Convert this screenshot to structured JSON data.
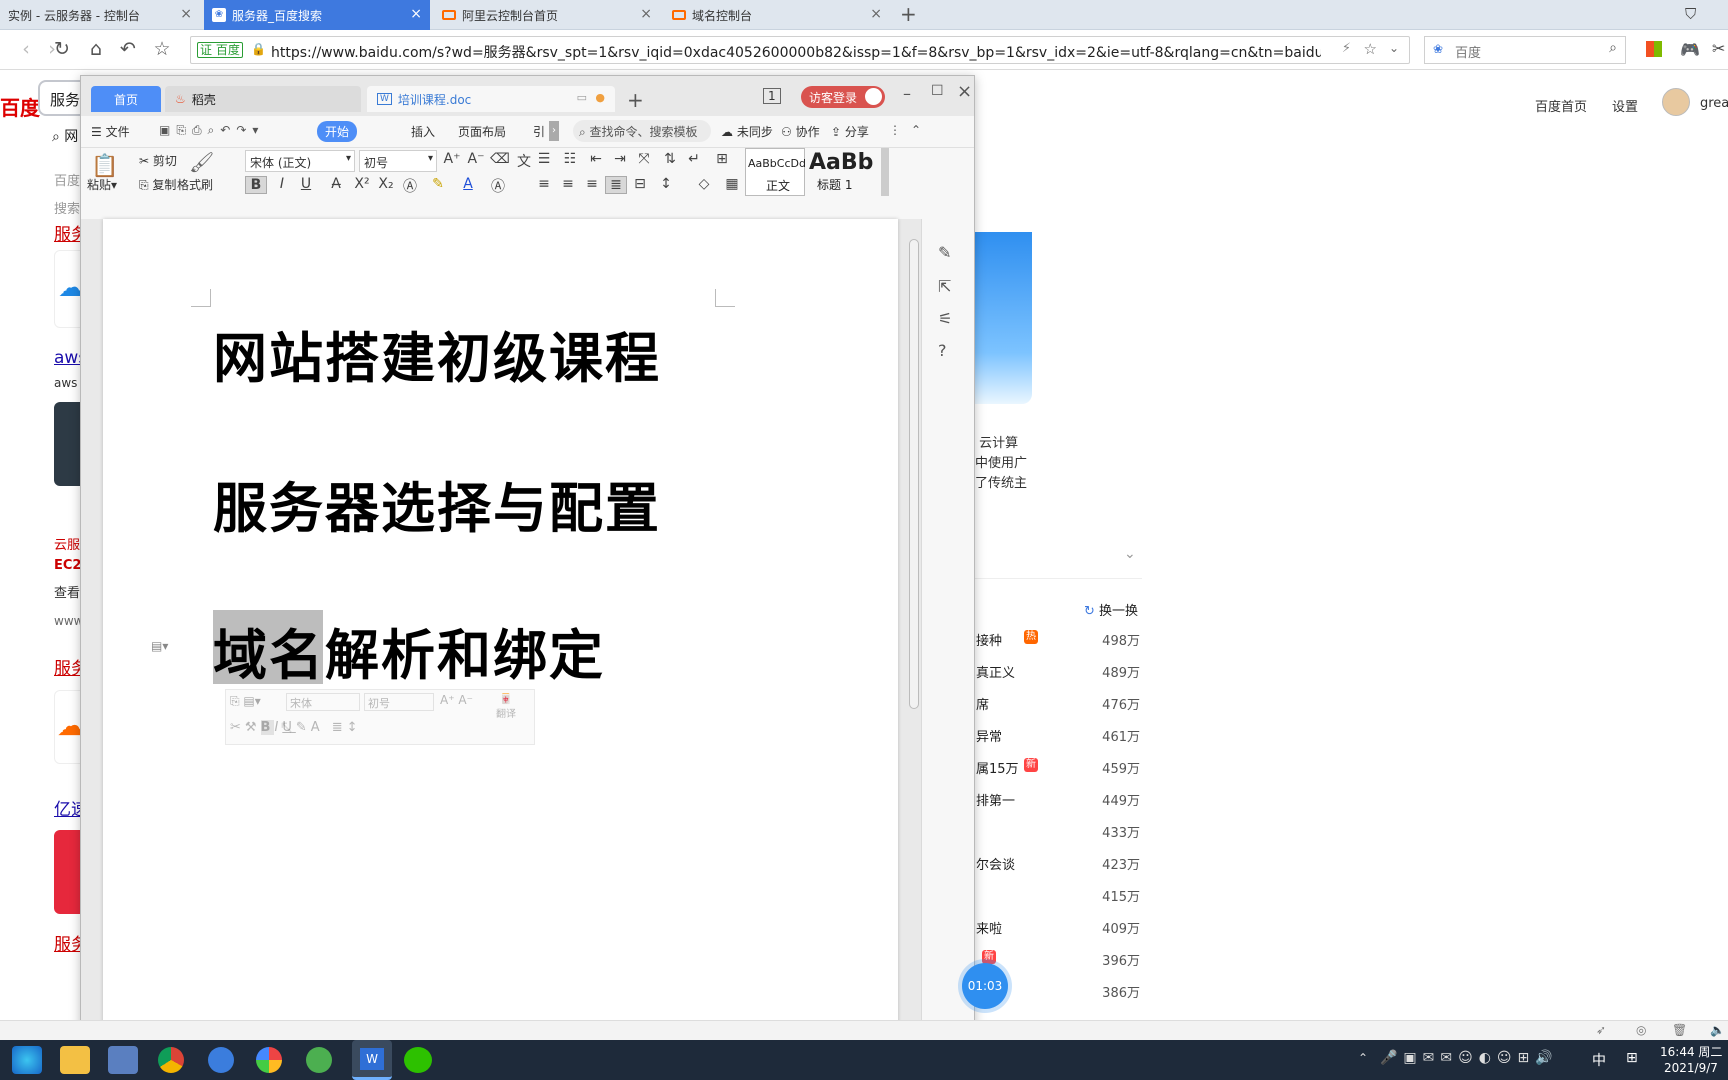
{
  "browser": {
    "tabs": [
      {
        "title": "实例 - 云服务器 - 控制台"
      },
      {
        "title": "服务器_百度搜索"
      },
      {
        "title": "阿里云控制台首页"
      },
      {
        "title": "域名控制台"
      }
    ],
    "cert_label": "证 百度",
    "url": "https://www.baidu.com/s?wd=服务器&rsv_spt=1&rsv_iqid=0xdac4052600000b82&issp=1&f=8&rsv_bp=1&rsv_idx=2&ie=utf-8&rqlang=cn&tn=baiduhome_p",
    "search_placeholder": "百度"
  },
  "baidu": {
    "logo_fragment": "百度",
    "query_fragment": "服务",
    "tab_fragment": "网",
    "header_links": {
      "home": "百度首页",
      "settings": "设置",
      "user": "great"
    },
    "left_fragments": [
      "百度",
      "搜索",
      "服务",
      "aws",
      "aws",
      "云服",
      "EC2",
      "查看",
      "www",
      "服务",
      "亿速",
      "服务"
    ],
    "right_card_text": [
      "用 云计算",
      "系中使用广",
      "决了传统主"
    ],
    "refresh_label": "换一换",
    "hot_list": [
      {
        "text": "接种",
        "badge": "热",
        "count": "498万"
      },
      {
        "text": "真正义",
        "badge": "",
        "count": "489万"
      },
      {
        "text": "席",
        "badge": "",
        "count": "476万"
      },
      {
        "text": "异常",
        "badge": "",
        "count": "461万"
      },
      {
        "text": "属15万",
        "badge": "新",
        "count": "459万"
      },
      {
        "text": "排第一",
        "badge": "",
        "count": "449万"
      },
      {
        "text": "",
        "badge": "",
        "count": "433万"
      },
      {
        "text": "尔会谈",
        "badge": "",
        "count": "423万"
      },
      {
        "text": "",
        "badge": "",
        "count": "415万"
      },
      {
        "text": "来啦",
        "badge": "",
        "count": "409万"
      },
      {
        "text": "",
        "badge": "新",
        "count": "396万"
      },
      {
        "text": "",
        "badge": "",
        "count": "386万"
      }
    ]
  },
  "wps": {
    "tabs": {
      "home": "首页",
      "daoke": "稻壳",
      "doc": "培训课程.doc"
    },
    "badge_num": "1",
    "guest_login": "访客登录",
    "ribbon_tabs": {
      "file": "文件",
      "start": "开始",
      "insert": "插入",
      "layout": "页面布局",
      "ref": "引",
      "search": "查找命令、搜索模板",
      "sync": "未同步",
      "collab": "协作",
      "share": "分享"
    },
    "clipboard": {
      "paste": "粘贴",
      "cut": "剪切",
      "copy": "复制",
      "format_painter": "格式刷"
    },
    "font_name": "宋体 (正文)",
    "font_size": "初号",
    "styles": {
      "normal_sample": "AaBbCcDd",
      "normal_label": "正文",
      "heading_sample": "AaBb",
      "heading_label": "标题 1"
    },
    "document": {
      "lines": [
        "网站搭建初级课程",
        "服务器选择与配置",
        "域名解析和绑定"
      ]
    },
    "mini_toolbar": {
      "font": "宋体",
      "size": "初号",
      "translate": "翻译"
    },
    "timer": "01:03"
  },
  "taskbar": {
    "ime": "中",
    "time": "16:44 周二",
    "date": "2021/9/7"
  }
}
